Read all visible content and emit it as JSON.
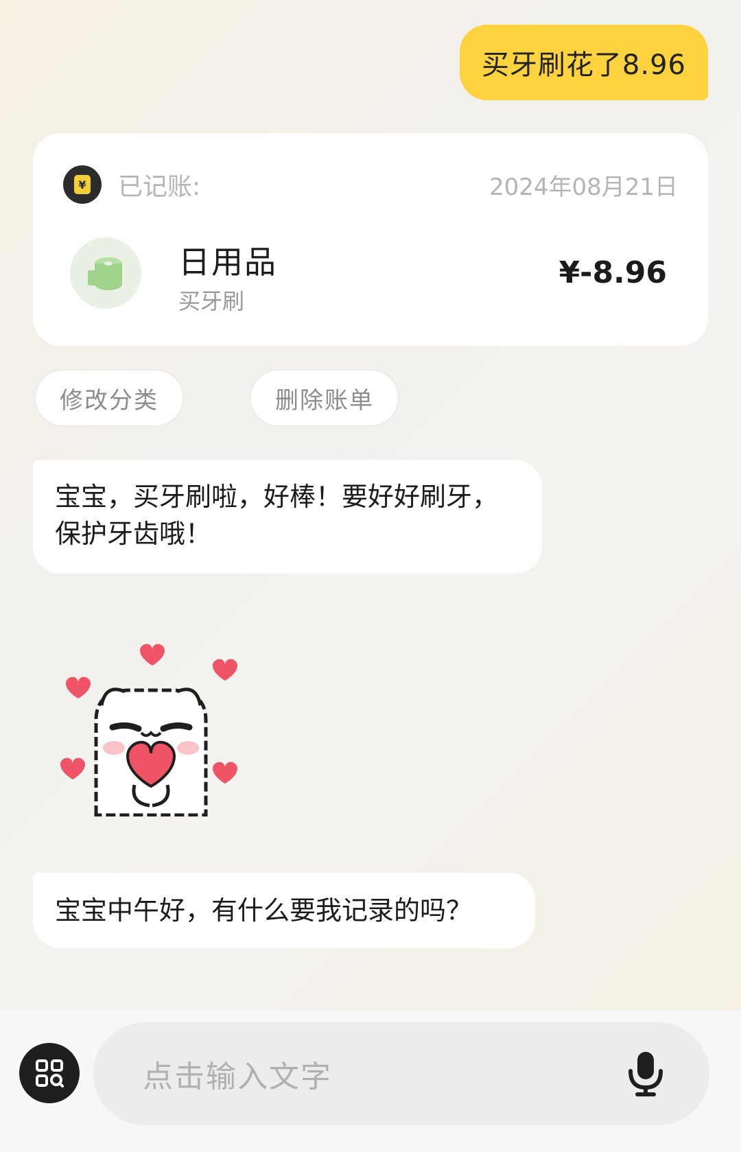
{
  "user_message": {
    "text": "买牙刷花了8.96"
  },
  "record_card": {
    "header_label": "已记账:",
    "date": "2024年08月21日",
    "category_name": "日用品",
    "note": "买牙刷",
    "amount": "¥-8.96",
    "category_icon": "toilet-paper-icon"
  },
  "actions": {
    "edit_category": "修改分类",
    "delete_bill": "删除账单"
  },
  "bot_messages": [
    {
      "text": "宝宝，买牙刷啦，好棒！要好好刷牙，保护牙齿哦！"
    },
    {
      "text": "宝宝中午好，有什么要我记录的吗？"
    }
  ],
  "sticker": {
    "name": "cat-holding-heart-sticker"
  },
  "input_bar": {
    "placeholder": "点击输入文字",
    "left_icon": "grid-menu-icon",
    "right_icon": "microphone-icon"
  },
  "colors": {
    "accent_yellow": "#fcd33e",
    "card_white": "#ffffff",
    "icon_green": "#9fd38a"
  }
}
